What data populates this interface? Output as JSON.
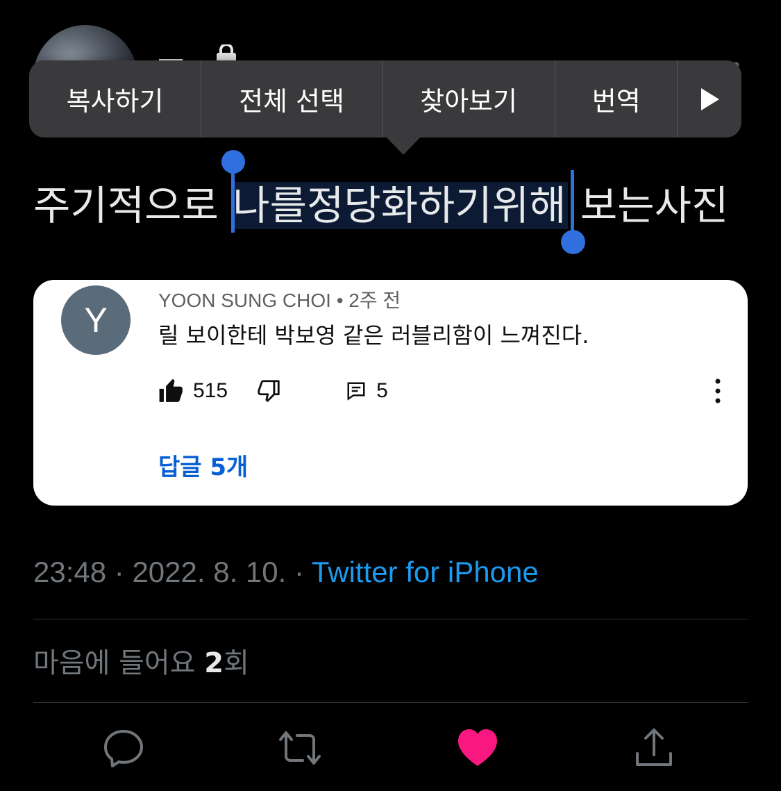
{
  "header": {
    "name_partial": "一"
  },
  "context_menu": {
    "items": [
      "복사하기",
      "전체 선택",
      "찾아보기",
      "번역"
    ],
    "more_icon": "play-right-icon"
  },
  "tweet": {
    "text_before": "주기적으로 ",
    "text_selected": "나를정당화하기위해",
    "text_after": " 보는사진"
  },
  "embedded_comment": {
    "avatar_letter": "Y",
    "author": "YOON SUNG CHOI",
    "separator": " • ",
    "time": "2주 전",
    "body": "릴 보이한테 박보영 같은 러블리함이 느껴진다.",
    "likes": "515",
    "replies_count": "5",
    "replies_link": "답글 5개"
  },
  "meta": {
    "time": "23:48",
    "sep1": " · ",
    "date": "2022. 8. 10.",
    "sep2": " · ",
    "source": "Twitter for iPhone"
  },
  "stats": {
    "likes_prefix": "마음에 들어요 ",
    "likes_count": "2",
    "likes_suffix": "회"
  },
  "actions": {
    "reply_icon": "reply-icon",
    "retweet_icon": "retweet-icon",
    "like_icon": "heart-icon",
    "share_icon": "share-icon"
  },
  "colors": {
    "heart": "#f91880",
    "link": "#1d9bf0",
    "selection_handle": "#2f6fde"
  }
}
